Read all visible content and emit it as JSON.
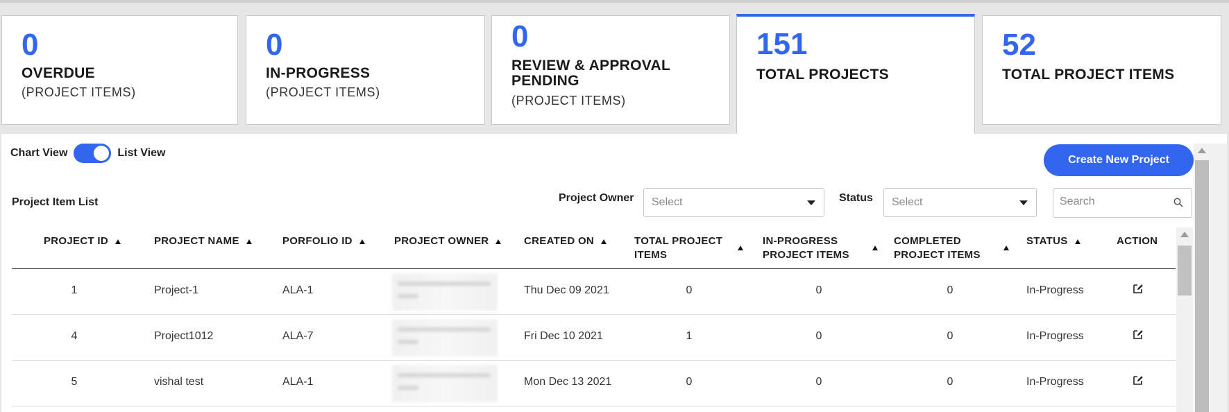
{
  "cards": [
    {
      "number": "0",
      "title": "OVERDUE",
      "subtitle": "(PROJECT ITEMS)"
    },
    {
      "number": "0",
      "title": "IN-PROGRESS",
      "subtitle": "(PROJECT ITEMS)"
    },
    {
      "number": "0",
      "title_line1": "REVIEW & APPROVAL",
      "title_line2": "PENDING",
      "subtitle": "(PROJECT ITEMS)"
    },
    {
      "number": "151",
      "title": "TOTAL PROJECTS"
    },
    {
      "number": "52",
      "title": "TOTAL PROJECT ITEMS"
    }
  ],
  "view_toggle": {
    "left_label": "Chart View",
    "right_label": "List View",
    "active": "List View"
  },
  "create_button": "Create New Project",
  "list_title": "Project Item List",
  "filters": {
    "owner_label": "Project Owner",
    "owner_placeholder": "Select",
    "status_label": "Status",
    "status_placeholder": "Select",
    "search_placeholder": "Search"
  },
  "table": {
    "headers": {
      "project_id": "PROJECT ID",
      "project_name": "PROJECT NAME",
      "portfolio_id": "PORFOLIO ID",
      "project_owner": "PROJECT OWNER",
      "created_on": "CREATED ON",
      "total_items_1": "TOTAL PROJECT",
      "total_items_2": "ITEMS",
      "inprogress_items_1": "IN-PROGRESS",
      "inprogress_items_2": "PROJECT ITEMS",
      "completed_items_1": "COMPLETED",
      "completed_items_2": "PROJECT ITEMS",
      "status": "STATUS",
      "action": "ACTION"
    },
    "rows": [
      {
        "id": "1",
        "name": "Project-1",
        "portfolio": "ALA-1",
        "created": "Thu Dec 09 2021",
        "total": "0",
        "inprogress": "0",
        "completed": "0",
        "status": "In-Progress"
      },
      {
        "id": "4",
        "name": "Project1012",
        "portfolio": "ALA-7",
        "created": "Fri Dec 10 2021",
        "total": "1",
        "inprogress": "0",
        "completed": "0",
        "status": "In-Progress"
      },
      {
        "id": "5",
        "name": "vishal test",
        "portfolio": "ALA-1",
        "created": "Mon Dec 13 2021",
        "total": "0",
        "inprogress": "0",
        "completed": "0",
        "status": "In-Progress"
      }
    ]
  },
  "colors": {
    "accent": "#3366ee",
    "background": "#e6e6e6"
  }
}
